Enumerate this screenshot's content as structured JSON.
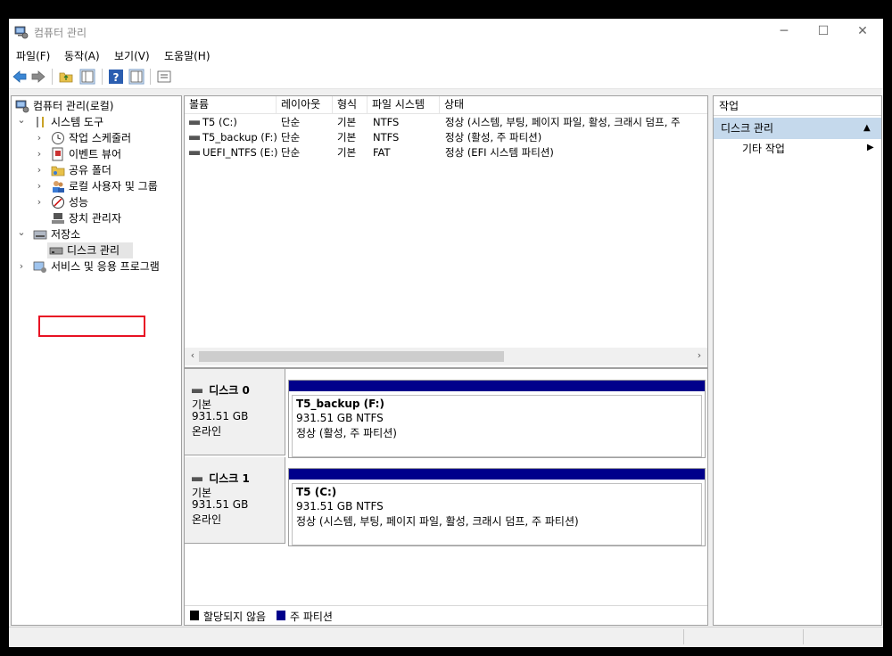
{
  "window": {
    "title": "컴퓨터 관리",
    "minimize": "─",
    "maximize": "☐",
    "close": "✕"
  },
  "menu": [
    "파일(F)",
    "동작(A)",
    "보기(V)",
    "도움말(H)"
  ],
  "toolbar": {
    "icons": [
      "back-arrow-icon",
      "forward-arrow-icon",
      "up-folder-icon",
      "show-hide-tree-icon",
      "help-icon",
      "show-hide-action-pane-icon",
      "properties-icon"
    ]
  },
  "tree": {
    "root": "컴퓨터 관리(로컬)",
    "system_tools": "시스템 도구",
    "task_scheduler": "작업 스케줄러",
    "event_viewer": "이벤트 뷰어",
    "shared_folders": "공유 폴더",
    "local_users": "로컬 사용자 및 그룹",
    "performance": "성능",
    "device_manager": "장치 관리자",
    "storage": "저장소",
    "disk_management": "디스크 관리",
    "services_apps": "서비스 및 응용 프로그램",
    "expand_glyph": "›",
    "collapse_glyph": "⌄"
  },
  "volume_table": {
    "columns": [
      "볼륨",
      "레이아웃",
      "형식",
      "파일 시스템",
      "상태"
    ],
    "rows": [
      [
        "T5 (C:)",
        "단순",
        "기본",
        "NTFS",
        "정상 (시스템, 부팅, 페이지 파일, 활성, 크래시 덤프, 주"
      ],
      [
        "T5_backup (F:)",
        "단순",
        "기본",
        "NTFS",
        "정상 (활성, 주 파티션)"
      ],
      [
        "UEFI_NTFS (E:)",
        "단순",
        "기본",
        "FAT",
        "정상 (EFI 시스템 파티션)"
      ]
    ],
    "scroll_left": "‹",
    "scroll_right": "›"
  },
  "disks": [
    {
      "name": "디스크 0",
      "type": "기본",
      "size": "931.51 GB",
      "state": "온라인",
      "partition": {
        "label": "T5_backup  (F:)",
        "size_fs": "931.51 GB NTFS",
        "status": "정상 (활성, 주 파티션)"
      }
    },
    {
      "name": "디스크 1",
      "type": "기본",
      "size": "931.51 GB",
      "state": "온라인",
      "partition": {
        "label": "T5  (C:)",
        "size_fs": "931.51 GB NTFS",
        "status": "정상 (시스템, 부팅, 페이지 파일, 활성, 크래시 덤프, 주 파티션)"
      }
    }
  ],
  "legend": {
    "unallocated": "할당되지 않음",
    "unallocated_color": "#000000",
    "primary": "주 파티션",
    "primary_color": "#00008b"
  },
  "actions": {
    "header": "작업",
    "section": "디스크 관리",
    "section_glyph": "▲",
    "item": "기타 작업",
    "item_glyph": "▶"
  },
  "colors": {
    "partition_bar": "#00008b",
    "selection": "#c5d9ec",
    "highlight_box": "#e81123"
  }
}
